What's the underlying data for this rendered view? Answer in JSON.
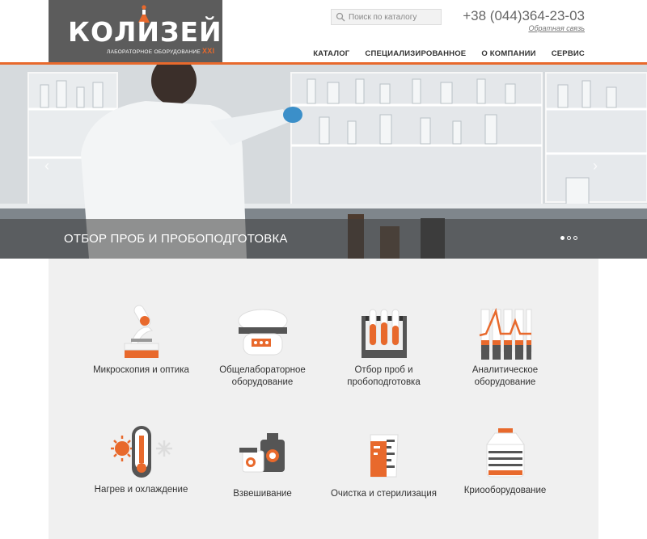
{
  "header": {
    "logo_text": "КОЛИЗЕЙ",
    "logo_tagline": "ЛАБОРАТОРНОЕ ОБОРУДОВАНИЕ",
    "logo_century": "XXI",
    "search_placeholder": "Поиск по каталогу",
    "phone": "+38 (044)364-23-03",
    "feedback": "Обратная связь",
    "nav": [
      "КАТАЛОГ",
      "СПЕЦИАЛИЗИРОВАННОЕ",
      "О КОМПАНИИ",
      "СЕРВИС"
    ]
  },
  "hero": {
    "caption": "ОТБОР ПРОБ И ПРОБОПОДГОТОВКА",
    "prev": "‹",
    "next": "›",
    "slides": 3,
    "active_slide": 1
  },
  "categories": [
    {
      "label": "Микроскопия и оптика",
      "icon": "microscope-icon"
    },
    {
      "label": "Общелабораторное оборудование",
      "icon": "lab-device-icon"
    },
    {
      "label": "Отбор проб и пробоподготовка",
      "icon": "test-tubes-icon"
    },
    {
      "label": "Аналитическое оборудование",
      "icon": "analytic-chart-icon"
    },
    {
      "label": "Нагрев и охлаждение",
      "icon": "thermometer-icon"
    },
    {
      "label": "Взвешивание",
      "icon": "scales-icon"
    },
    {
      "label": "Очистка и стерилизация",
      "icon": "beaker-icon"
    },
    {
      "label": "Криооборудование",
      "icon": "cryo-container-icon"
    }
  ],
  "colors": {
    "accent": "#e8692c",
    "dark": "#5c5c5c",
    "panel": "#f0f0f0"
  }
}
